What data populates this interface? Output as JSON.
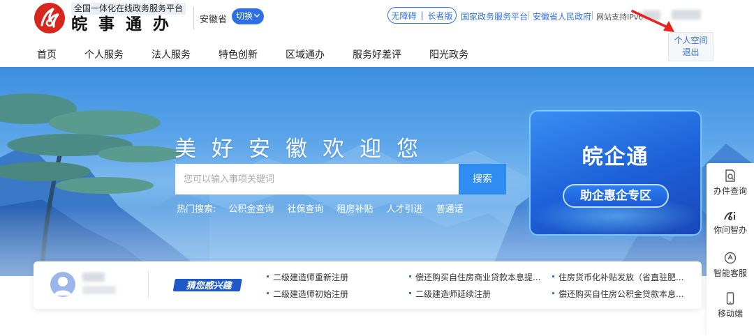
{
  "header": {
    "logo_tagline": "全国一体化在线政务服务平台",
    "logo_name": "皖事通办",
    "province": "安徽省",
    "switch_label": "切换",
    "accessibility": "无障碍",
    "elder_mode": "长者版",
    "links": [
      "国家政务服务平台",
      "安徽省人民政府"
    ],
    "ipv6_text": "网站支持IPv6",
    "user_menu": {
      "personal_space": "个人空间",
      "logout": "退出"
    }
  },
  "nav": {
    "items": [
      "首页",
      "个人服务",
      "法人服务",
      "特色创新",
      "区域通办",
      "服务好差评",
      "阳光政务"
    ]
  },
  "banner": {
    "welcome": "美好安徽欢迎您",
    "search_placeholder": "您可以输入事项关键词",
    "search_button": "搜索",
    "hot_label": "热门搜索:",
    "hot_items": [
      "公积金查询",
      "社保查询",
      "租房补贴",
      "人才引进",
      "普通话"
    ],
    "promo_title": "皖企通",
    "promo_subtitle": "助企惠企专区"
  },
  "sidebar": {
    "items": [
      {
        "label": "办件查询",
        "icon": "document-search-icon"
      },
      {
        "label": "你问智办",
        "icon": "ai-assistant-icon"
      },
      {
        "label": "智能客服",
        "icon": "robot-icon"
      },
      {
        "label": "移动端",
        "icon": "mobile-phone-icon"
      }
    ]
  },
  "info_card": {
    "interest_label": "猜您感兴趣",
    "items": [
      "二级建造师重新注册",
      "偿还购买自住房商业贷款本息提...",
      "住房货币化补贴发放（省直驻肥...",
      "二级建造师初始注册",
      "二级建造师延续注册",
      "偿还购买自住房公积金贷款本息..."
    ]
  },
  "colors": {
    "accent": "#2f6fe4",
    "search_button": "#2f8cf0",
    "logo_red": "#d7261e",
    "annotation_arrow": "#e8231d"
  }
}
